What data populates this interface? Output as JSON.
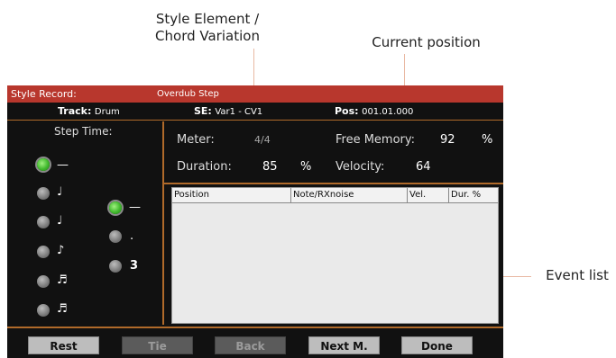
{
  "callouts": {
    "style_element_line1": "Style Element /",
    "style_element_line2": "Chord Variation",
    "current_position": "Current position",
    "event_list": "Event list"
  },
  "titlebar": {
    "mode": "Style Record:",
    "page": "Overdub Step"
  },
  "infobar": {
    "track_label": "Track:",
    "track_value": "Drum",
    "se_label": "SE:",
    "se_value": "Var1 - CV1",
    "pos_label": "Pos:",
    "pos_value": "001.01.000"
  },
  "step_time": {
    "label": "Step Time:",
    "note_values": [
      "half-note",
      "quarter-note",
      "quarter-note-2",
      "eighth-note",
      "sixteenth-note",
      "thirty-second-note"
    ],
    "selected_index": 0,
    "modifiers": {
      "dash": "—",
      "dot": ".",
      "triplet": "3"
    },
    "selected_modifier": "dash"
  },
  "meta": {
    "meter_label": "Meter:",
    "meter_value": "4/4",
    "free_memory_label": "Free Memory:",
    "free_memory_value": "92",
    "free_memory_unit": "%",
    "duration_label": "Duration:",
    "duration_value": "85",
    "duration_unit": "%",
    "velocity_label": "Velocity:",
    "velocity_value": "64"
  },
  "event_list": {
    "columns": [
      "Position",
      "Note/RXnoise",
      "Vel.",
      "Dur. %"
    ],
    "rows": []
  },
  "buttons": {
    "rest": "Rest",
    "tie": "Tie",
    "back": "Back",
    "next": "Next M.",
    "done": "Done"
  },
  "colors": {
    "title_bar": "#b8372d",
    "accent_border": "#b06a2a",
    "selected_green": "#3fb82c"
  }
}
